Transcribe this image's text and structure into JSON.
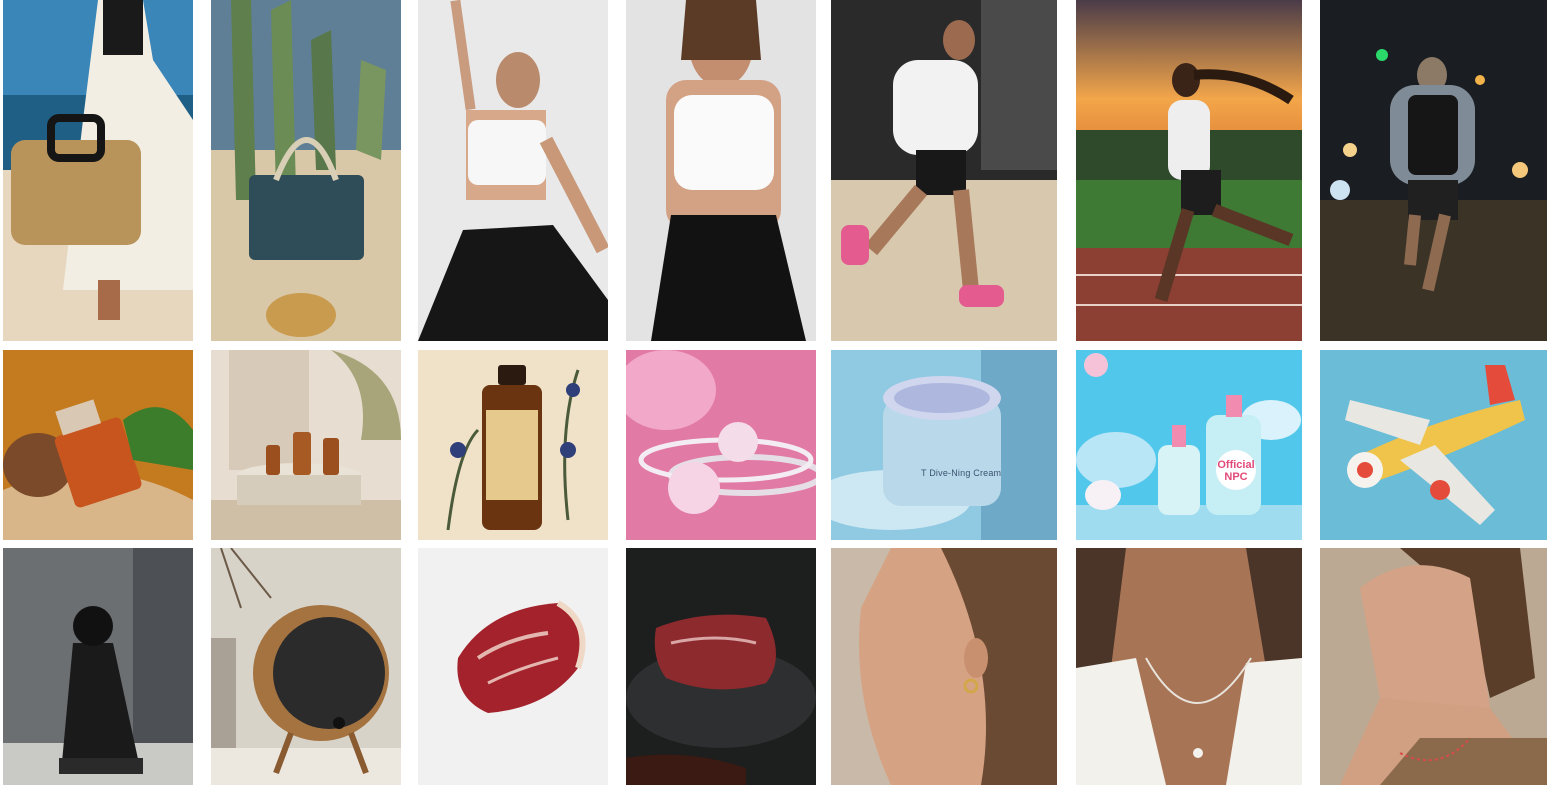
{
  "gallery": {
    "tiles": [
      {
        "subject": "woman-with-woven-beach-bag-icon"
      },
      {
        "subject": "woven-handbag-with-cactus-icon"
      },
      {
        "subject": "yoga-woman-white-top-icon"
      },
      {
        "subject": "woman-white-sports-bra-icon"
      },
      {
        "subject": "man-running-hoodie-icon"
      },
      {
        "subject": "woman-running-track-sunset-icon"
      },
      {
        "subject": "man-running-night-street-icon"
      },
      {
        "subject": "perfume-bottle-sand-icon"
      },
      {
        "subject": "serum-bottles-pedestal-icon"
      },
      {
        "subject": "vintage-apothecary-bottle-icon"
      },
      {
        "subject": "diamond-ring-pink-icon"
      },
      {
        "subject": "cream-jar-water-icon",
        "label": "T Dive-Ning Cream"
      },
      {
        "subject": "cartoon-pump-bottles-icon",
        "label_line1": "Official",
        "label_line2": "NPC"
      },
      {
        "subject": "toy-airplane-icon"
      },
      {
        "subject": "black-cone-speaker-icon"
      },
      {
        "subject": "wooden-round-speaker-icon"
      },
      {
        "subject": "raw-steak-white-icon"
      },
      {
        "subject": "raw-steak-dark-stone-icon"
      },
      {
        "subject": "woman-profile-earring-icon"
      },
      {
        "subject": "woman-necklace-closeup-icon"
      },
      {
        "subject": "woman-short-hair-necklace-icon"
      }
    ]
  }
}
